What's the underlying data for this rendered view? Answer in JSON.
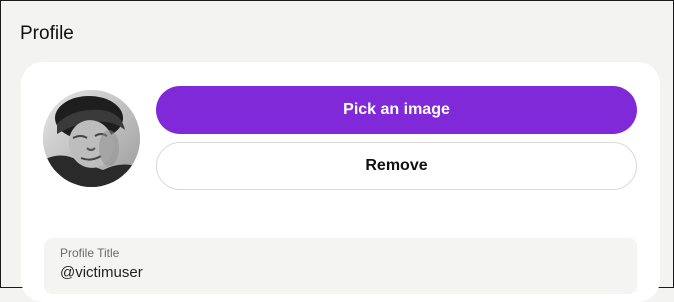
{
  "section": {
    "title": "Profile"
  },
  "avatar": {
    "icon": "user-photo"
  },
  "actions": {
    "pick_image_label": "Pick an image",
    "remove_label": "Remove"
  },
  "profile_title": {
    "label": "Profile Title",
    "value": "@victimuser"
  },
  "colors": {
    "accent": "#8029d8",
    "page_background": "#f3f3f1",
    "card_background": "#ffffff",
    "field_background": "#f4f4f2"
  }
}
